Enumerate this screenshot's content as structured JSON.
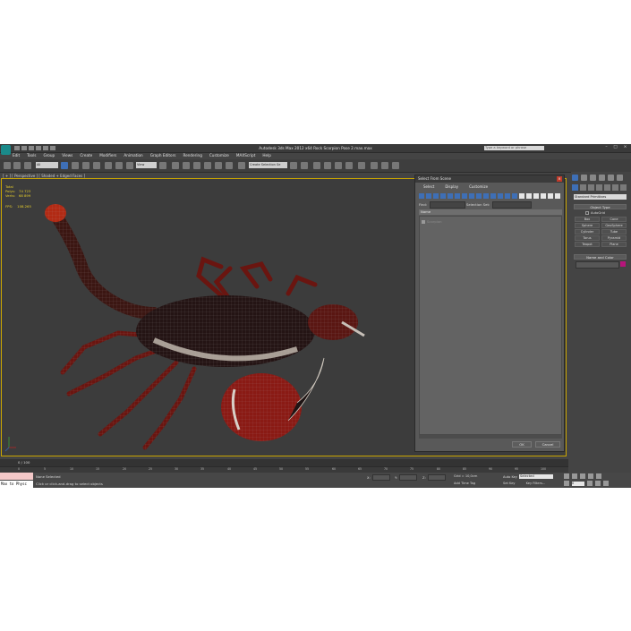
{
  "titlebar": {
    "title": "Autodesk 3ds Max 2012 x64     Rock Scorpion Pose 2.max.max",
    "search_placeholder": "Type a keyword or phrase",
    "minimize": "–",
    "maximize": "□",
    "close": "×"
  },
  "menu": [
    "Edit",
    "Tools",
    "Group",
    "Views",
    "Create",
    "Modifiers",
    "Animation",
    "Graph Editors",
    "Rendering",
    "Customize",
    "MAXScript",
    "Help"
  ],
  "toolbar": {
    "selection_filter": "All",
    "reference_coord": "View",
    "named_selection": "Create Selection Se"
  },
  "viewport": {
    "label": "[ + ] [ Perspective ] [ Shaded + Edged Faces ]",
    "stats": {
      "header": "Total",
      "rows": [
        {
          "label": "Polys:",
          "value": "74 723"
        },
        {
          "label": "Verts:",
          "value": "68 899"
        }
      ],
      "fps_label": "FPS:",
      "fps_value": "108.265"
    }
  },
  "dialog": {
    "title": "Select From Scene",
    "close": "×",
    "tabs": [
      "Select",
      "Display",
      "Customize"
    ],
    "find_label": "Find:",
    "find_value": "",
    "selection_set_label": "Selection Set:",
    "column_header": "Name",
    "items": [
      "Scorpion"
    ],
    "ok": "OK",
    "cancel": "Cancel"
  },
  "command_panel": {
    "category": "Standard Primitives",
    "object_type_title": "Object Type",
    "autogrid_label": "AutoGrid",
    "object_types": [
      "Box",
      "Cone",
      "Sphere",
      "GeoSphere",
      "Cylinder",
      "Tube",
      "Torus",
      "Pyramid",
      "Teapot",
      "Plane"
    ],
    "name_color_title": "Name and Color",
    "name_value": "",
    "object_color": "#b5147a"
  },
  "timeline": {
    "slider_label": "0 / 100",
    "ticks": [
      "0",
      "5",
      "10",
      "15",
      "20",
      "25",
      "30",
      "35",
      "40",
      "45",
      "50",
      "55",
      "60",
      "65",
      "70",
      "75",
      "80",
      "85",
      "90",
      "95",
      "100"
    ]
  },
  "status": {
    "maxscript_text": "Max to Physc",
    "selection": "None Selected",
    "prompt": "Click or click-and-drag to select objects",
    "x_label": "X:",
    "y_label": "Y:",
    "z_label": "Z:",
    "grid": "Grid = 10,0cm",
    "add_time_tag": "Add Time Tag",
    "auto_key": "Auto Key",
    "auto_key_mode": "Selected",
    "set_key": "Set Key",
    "key_filters": "Key Filters...",
    "current_frame": "0"
  },
  "colors": {
    "accent_yellow": "#caa500",
    "scorpion_red": "#8a1a14",
    "stats_yellow": "#e8cf2a"
  }
}
